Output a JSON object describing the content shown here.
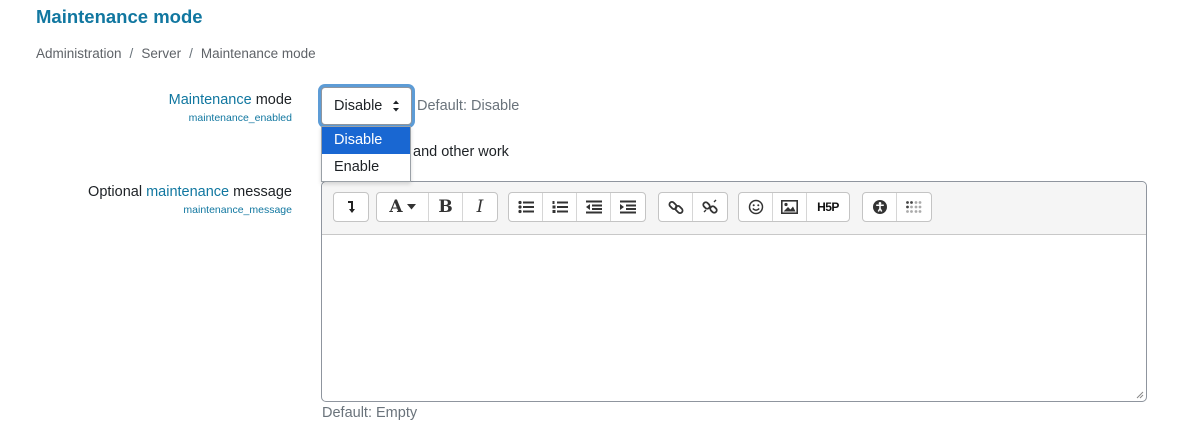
{
  "page": {
    "title": "Maintenance mode"
  },
  "breadcrumb": {
    "items": [
      "Administration",
      "Server",
      "Maintenance mode"
    ],
    "separator": "/"
  },
  "setting_enabled": {
    "label_highlight": "Maintenance",
    "label_rest": " mode",
    "key_highlight": "maintenance",
    "key_rest": "_enabled",
    "select_value": "Disable",
    "default_text": "Default: Disable",
    "description_fragment": "and other work",
    "options": [
      "Disable",
      "Enable"
    ],
    "selected_option": "Disable"
  },
  "setting_message": {
    "label_pre": "Optional ",
    "label_highlight": "maintenance",
    "label_rest": " message",
    "key_highlight": "maintenance",
    "key_rest": "_message",
    "default_text": "Default: Empty",
    "editor_value": ""
  },
  "editor_toolbar": {
    "buttons": [
      "show-more-icon",
      "font-style-icon",
      "bold-icon",
      "italic-icon",
      "unordered-list-icon",
      "ordered-list-icon",
      "outdent-icon",
      "indent-icon",
      "link-icon",
      "unlink-icon",
      "emoji-icon",
      "image-icon",
      "h5p-icon",
      "accessibility-checker-icon",
      "screenreader-helper-icon"
    ],
    "bold_glyph": "B",
    "italic_glyph": "I",
    "font_glyph": "A",
    "h5p_glyph": "H5P"
  },
  "colors": {
    "accent": "#1177a0",
    "focus_ring": "#5d9cd6",
    "selected_option_bg": "#1967d2"
  }
}
